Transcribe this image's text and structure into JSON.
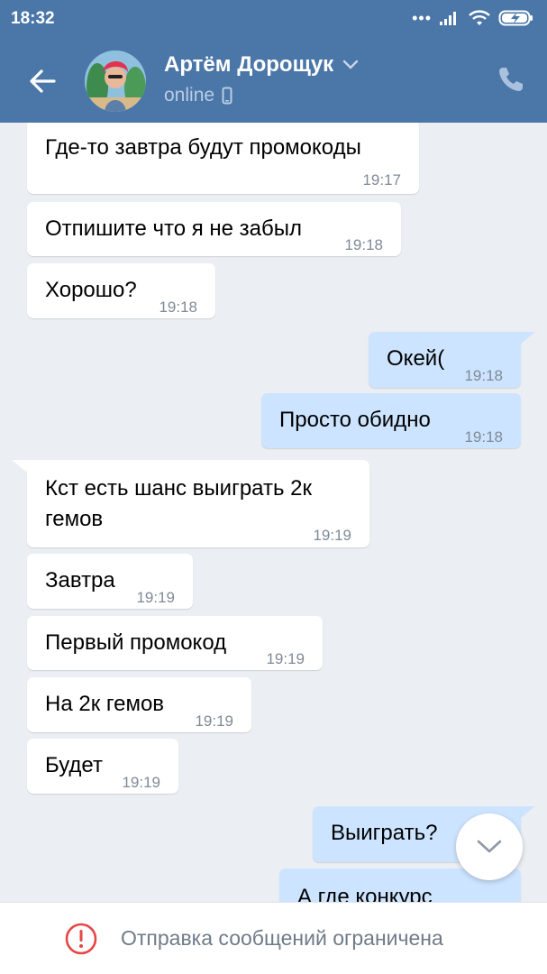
{
  "status_bar": {
    "time": "18:32",
    "dots": "•••"
  },
  "header": {
    "name": "Артём Дорощук",
    "status": "online",
    "colors": {
      "bar": "#4a76a8",
      "status_text": "#b9cde3"
    }
  },
  "messages": [
    {
      "side": "in",
      "text": "Где-то завтра будут промокоды",
      "time": "19:17"
    },
    {
      "side": "in",
      "text": "Отпишите что я не забыл",
      "time": "19:18"
    },
    {
      "side": "in",
      "text": "Хорошо?",
      "time": "19:18"
    },
    {
      "side": "out",
      "text": "Окей(",
      "time": "19:18"
    },
    {
      "side": "out",
      "text": "Просто обидно",
      "time": "19:18"
    },
    {
      "side": "in",
      "text_line1": "Кст есть шанс выиграть 2к",
      "text_line2": "гемов",
      "time": "19:19"
    },
    {
      "side": "in",
      "text": "Завтра",
      "time": "19:19"
    },
    {
      "side": "in",
      "text": "Первый промокод",
      "time": "19:19"
    },
    {
      "side": "in",
      "text": "На 2к гемов",
      "time": "19:19"
    },
    {
      "side": "in",
      "text": "Будет",
      "time": "19:19"
    },
    {
      "side": "out",
      "text": "Выиграть?",
      "time": ""
    },
    {
      "side": "out",
      "text": "А где конкурс",
      "time": ""
    }
  ],
  "bottom_bar": {
    "notice": "Отправка сообщений ограничена",
    "warn_color": "#e64646"
  }
}
